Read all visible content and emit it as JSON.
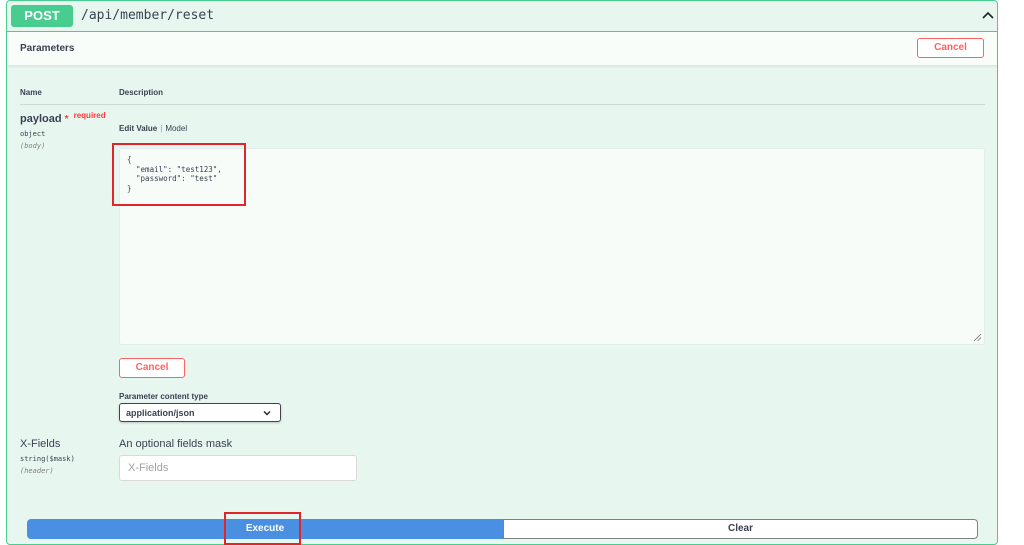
{
  "operation": {
    "method": "POST",
    "path": "/api/member/reset",
    "collapse_icon": "chevron-up-icon"
  },
  "parameters": {
    "title": "Parameters",
    "cancel_label": "Cancel",
    "columns": {
      "name": "Name",
      "description": "Description"
    },
    "payload": {
      "name": "payload",
      "required_star": "*",
      "required_label": "required",
      "type": "object",
      "in": "(body)",
      "tab_edit": "Edit Value",
      "tab_sep": "|",
      "tab_model": "Model",
      "body_text": "{\n  \"email\": \"test123\",\n  \"password\": \"test\"\n}",
      "cancel_label": "Cancel",
      "content_type_label": "Parameter content type",
      "content_type_value": "application/json"
    },
    "x_fields": {
      "name": "X-Fields",
      "type": "string($mask)",
      "in": "(header)",
      "description": "An optional fields mask",
      "placeholder": "X-Fields"
    }
  },
  "actions": {
    "execute_label": "Execute",
    "clear_label": "Clear"
  },
  "colors": {
    "post_green": "#49cc90",
    "cancel_red": "#ff6060",
    "execute_blue": "#4990e2",
    "highlight_red": "#e0262b"
  }
}
